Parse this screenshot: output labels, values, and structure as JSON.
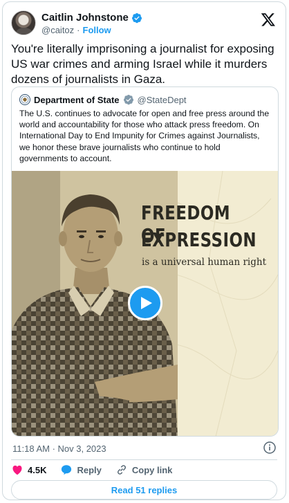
{
  "author": {
    "name": "Caitlin Johnstone",
    "handle": "@caitoz",
    "separator": "·",
    "follow_label": "Follow"
  },
  "tweet": {
    "text": "You're literally imprisoning a journalist for exposing US war crimes and arming Israel while it murders dozens of journalists in Gaza.",
    "timestamp": "11:18 AM · Nov 3, 2023"
  },
  "quoted": {
    "name": "Department of State",
    "handle": "@StateDept",
    "text": "The U.S. continues to advocate for open and free press around the world and accountability for those who attack press freedom. On International Day to End Impunity for Crimes against Journalists, we honor these brave journalists who continue to hold governments to account.",
    "media": {
      "headline_line1": "FREEDOM OF",
      "headline_line2": "EXPRESSION",
      "subheadline": "is a universal human right"
    }
  },
  "actions": {
    "likes": "4.5K",
    "reply_label": "Reply",
    "copy_link_label": "Copy link",
    "read_replies_label": "Read 51 replies"
  },
  "colors": {
    "accent": "#1d9bf0",
    "like": "#f91880",
    "media_bg": "#f2ecd2",
    "text_secondary": "#536471"
  },
  "icons": [
    "verified-icon",
    "x-logo-icon",
    "state-seal-icon",
    "play-icon",
    "info-icon",
    "heart-icon",
    "reply-icon",
    "link-icon"
  ]
}
